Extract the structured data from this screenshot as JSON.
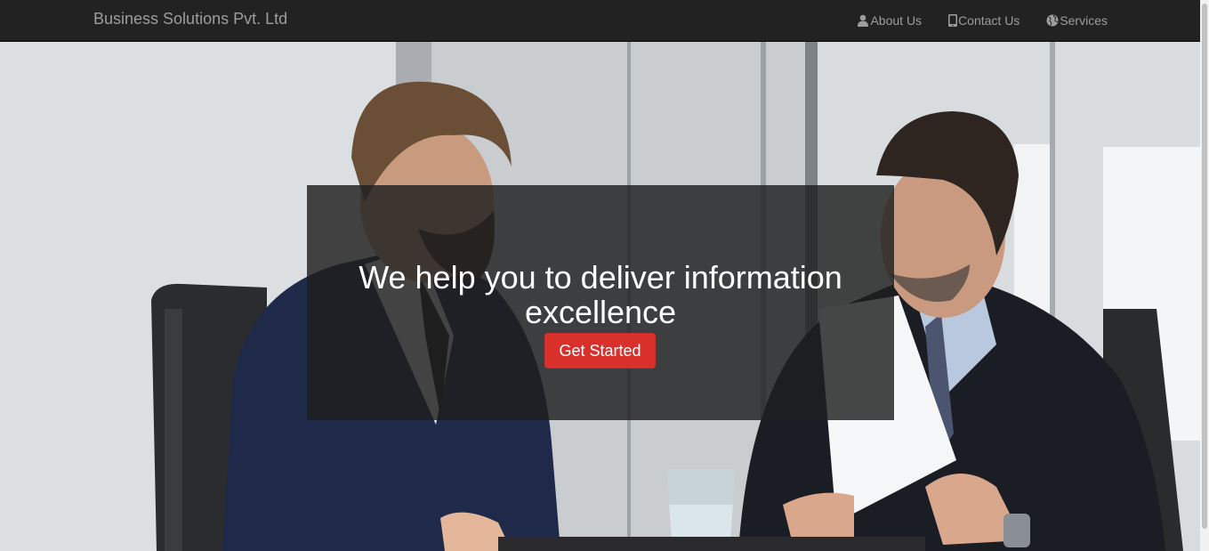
{
  "navbar": {
    "brand": "Business Solutions Pvt. Ltd",
    "links": [
      {
        "label": "About Us",
        "icon": "user-icon"
      },
      {
        "label": "Contact Us",
        "icon": "phone-icon"
      },
      {
        "label": "Services",
        "icon": "globe-icon"
      }
    ]
  },
  "hero": {
    "headline": "We help you to deliver information excellence",
    "cta_label": "Get Started"
  },
  "colors": {
    "navbar_bg": "#222222",
    "nav_text": "#9d9d9d",
    "cta_bg": "#d9302b",
    "overlay_bg": "rgba(30,30,30,0.82)"
  }
}
